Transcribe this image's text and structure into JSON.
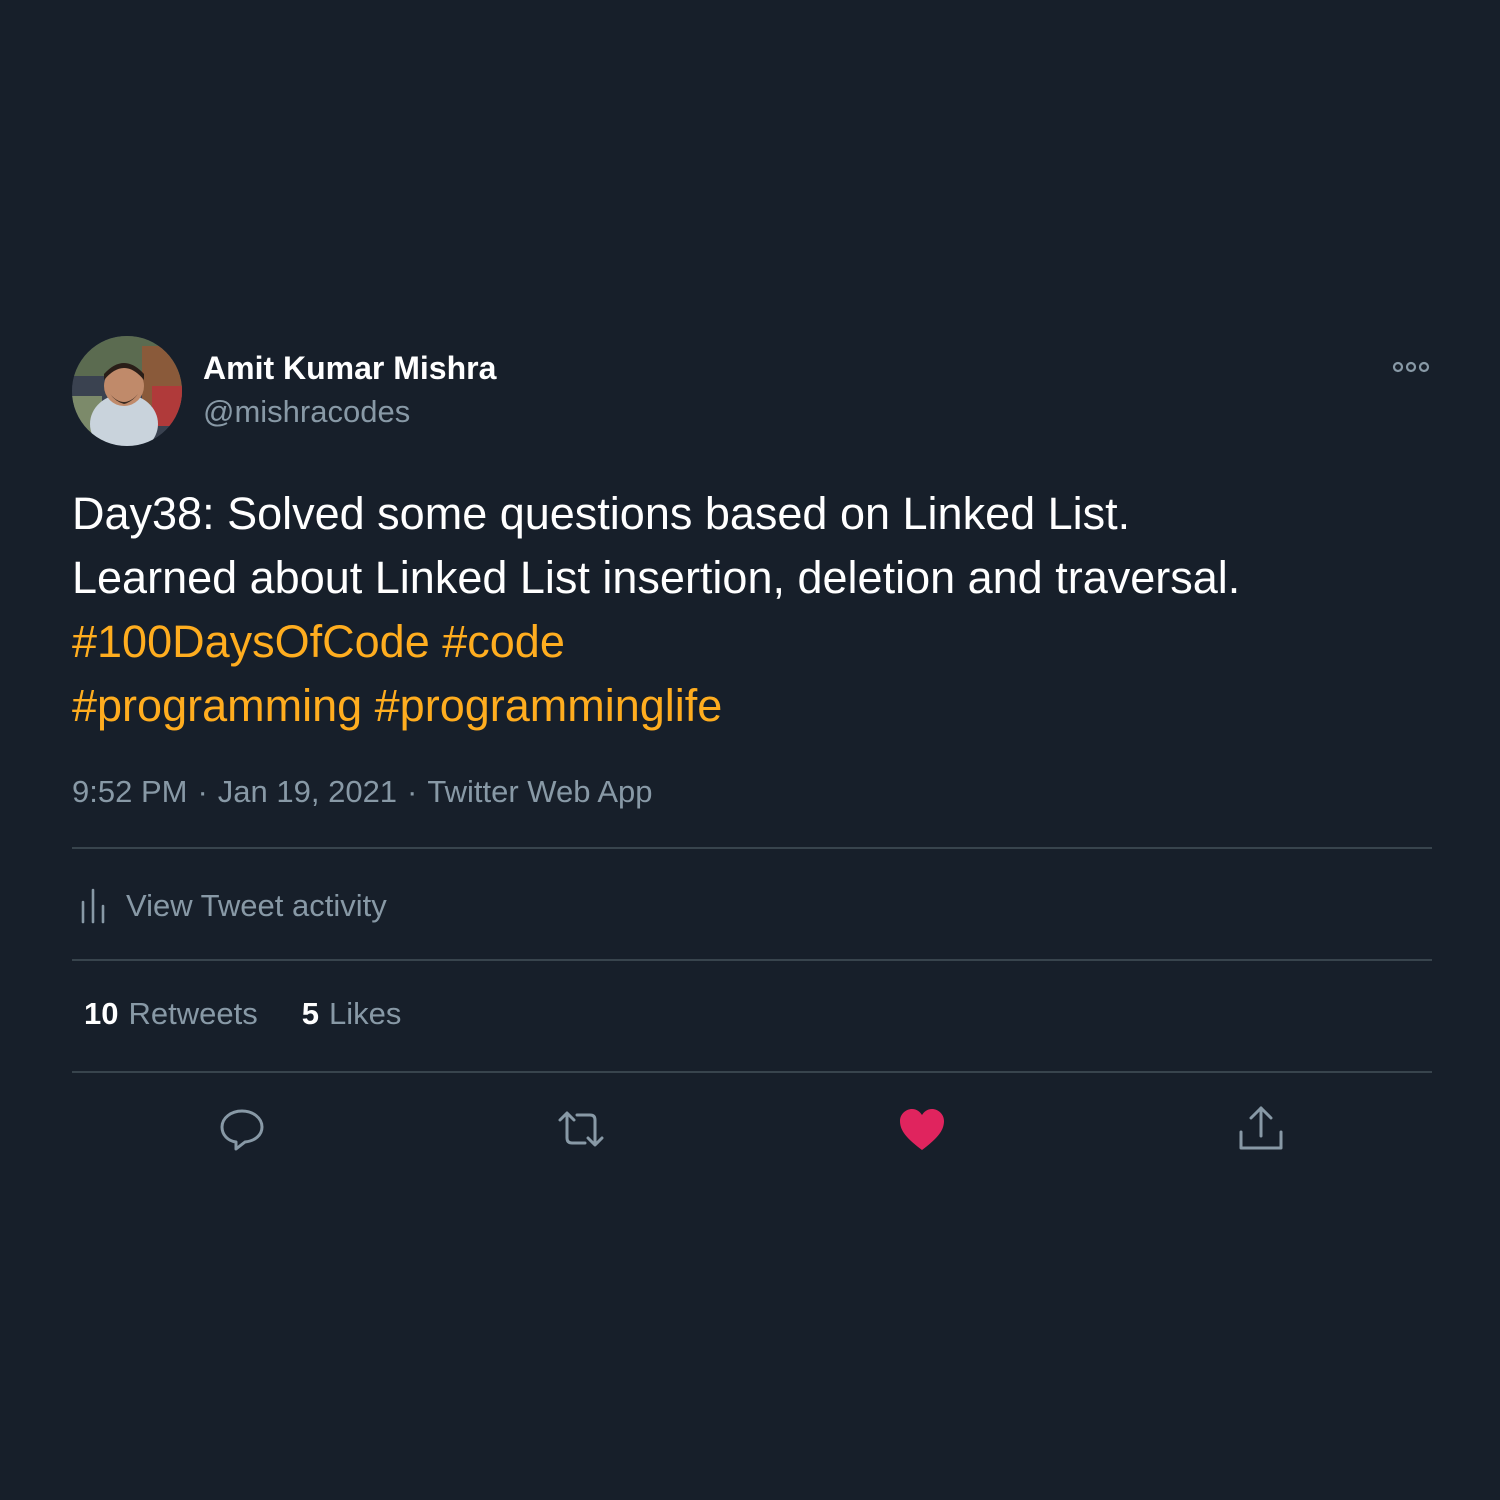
{
  "tweet": {
    "author": {
      "name": "Amit Kumar Mishra",
      "handle": "@mishracodes"
    },
    "text": {
      "line1": "Day38: Solved some questions based on Linked List.",
      "line2": "Learned about Linked List insertion, deletion and traversal.",
      "hashtags_line1": [
        "#100DaysOfCode",
        "#code"
      ],
      "hashtags_line2": [
        "#programming",
        "#programminglife"
      ]
    },
    "meta": {
      "time": "9:52 PM",
      "date": "Jan 19, 2021",
      "source": "Twitter Web App",
      "separator": "·"
    },
    "activity_label": "View Tweet activity",
    "stats": {
      "retweets_count": "10",
      "retweets_label": "Retweets",
      "likes_count": "5",
      "likes_label": "Likes"
    },
    "actions": [
      "reply-icon",
      "retweet-icon",
      "like-icon",
      "share-icon"
    ],
    "liked": true
  },
  "colors": {
    "background": "#171f2a",
    "text": "#ffffff",
    "secondary_text": "#8899a6",
    "hashtag": "#ffad1f",
    "divider": "#38444d",
    "like": "#e0245e"
  }
}
